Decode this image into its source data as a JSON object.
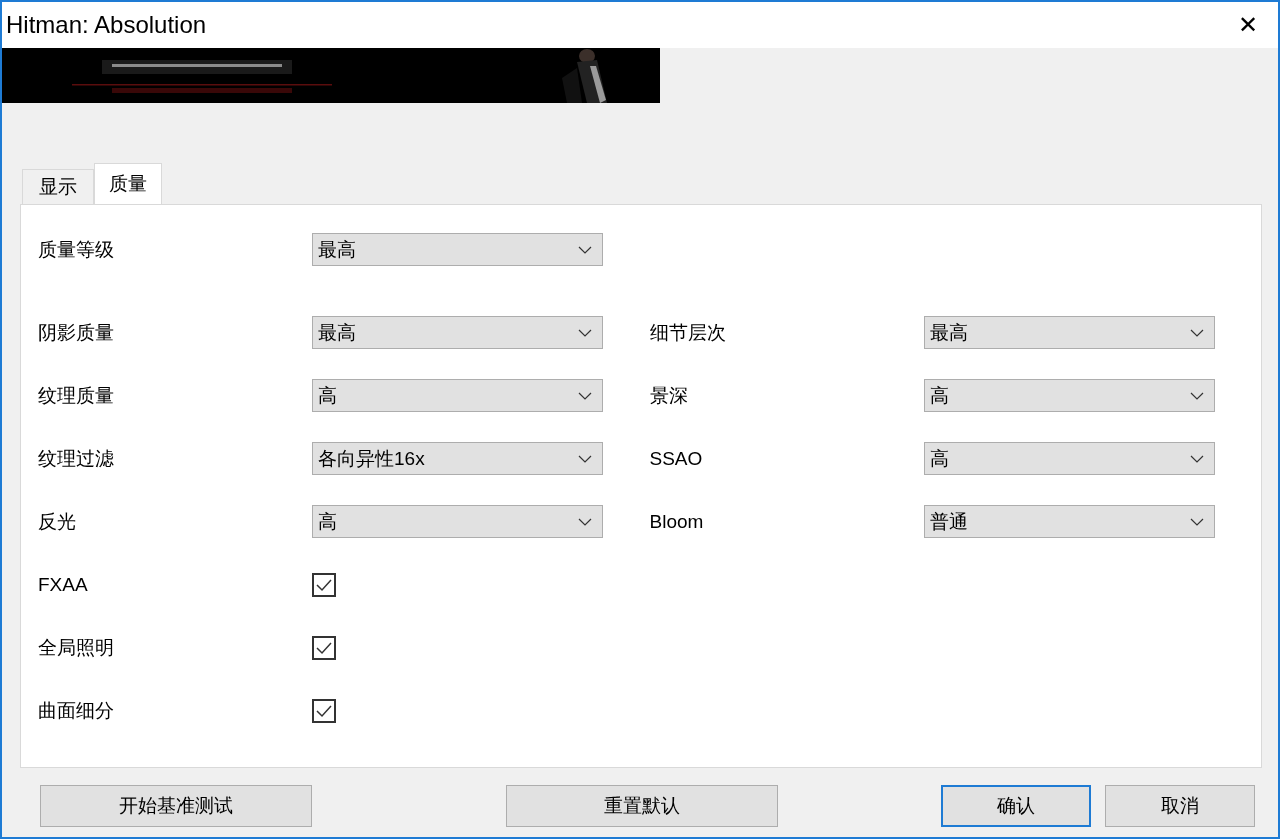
{
  "window": {
    "title": "Hitman: Absolution",
    "close": "✕"
  },
  "tabs": [
    {
      "label": "显示",
      "selected": false
    },
    {
      "label": "质量",
      "selected": true
    }
  ],
  "rows": [
    {
      "items": [
        {
          "kind": "dropdown",
          "label": "质量等级",
          "value": "最高"
        }
      ]
    },
    {
      "items": [
        {
          "kind": "dropdown",
          "label": "阴影质量",
          "value": "最高"
        },
        {
          "kind": "dropdown",
          "label": "细节层次",
          "value": "最高"
        }
      ]
    },
    {
      "items": [
        {
          "kind": "dropdown",
          "label": "纹理质量",
          "value": "高"
        },
        {
          "kind": "dropdown",
          "label": "景深",
          "value": "高"
        }
      ]
    },
    {
      "items": [
        {
          "kind": "dropdown",
          "label": "纹理过滤",
          "value": "各向异性16x"
        },
        {
          "kind": "dropdown",
          "label": "SSAO",
          "value": "高"
        }
      ]
    },
    {
      "items": [
        {
          "kind": "dropdown",
          "label": "反光",
          "value": "高"
        },
        {
          "kind": "dropdown",
          "label": "Bloom",
          "value": "普通"
        }
      ]
    },
    {
      "items": [
        {
          "kind": "checkbox",
          "label": "FXAA",
          "checked": true
        }
      ]
    },
    {
      "items": [
        {
          "kind": "checkbox",
          "label": "全局照明",
          "checked": true
        }
      ]
    },
    {
      "items": [
        {
          "kind": "checkbox",
          "label": "曲面细分",
          "checked": true
        }
      ]
    }
  ],
  "buttons": [
    {
      "label": "开始基准测试",
      "focused": false
    },
    {
      "label": "重置默认",
      "focused": false
    },
    {
      "label": "确认",
      "focused": true
    },
    {
      "label": "取消",
      "focused": false
    }
  ]
}
